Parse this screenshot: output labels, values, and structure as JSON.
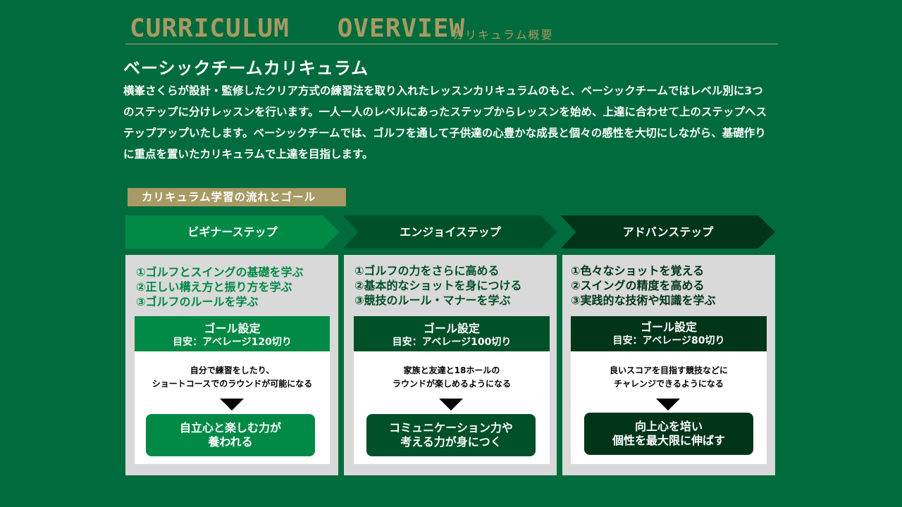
{
  "header": {
    "title_en": "CURRICULUM   OVERVIEW",
    "title_ja": "カリキュラム概要"
  },
  "course": {
    "title": "ベーシックチームカリキュラム",
    "intro": "横峯さくらが設計・監修したクリア方式の練習法を取り入れたレッスンカリキュラムのもと、ベーシックチームではレベル別に3つのステップに分けレッスンを行います。一人一人のレベルにあったステップからレッスンを始め、上達に合わせて上のステップへステップアップいたします。ベーシックチームでは、ゴルフを通して子供達の心豊かな成長と個々の感性を大切にしながら、基礎作りに重点を置いたカリキュラムで上達を目指します。"
  },
  "flow_label": "カリキュラム学習の流れとゴール",
  "colors": {
    "background": "#006b3c",
    "gold": "#a89a64",
    "step1": "#008a46",
    "step2": "#005028",
    "step3": "#003519"
  },
  "steps": [
    {
      "name": "ビギナーステップ",
      "points": [
        "①ゴルフとスイングの基礎を学ぶ",
        "②正しい構え方と振り方を学ぶ",
        "③ゴルフのルールを学ぶ"
      ],
      "goal_title": "ゴール設定",
      "goal_target": "目安：アベレージ120切り",
      "desc": [
        "自分で練習をしたり、",
        "ショートコースでのラウンドが可能になる"
      ],
      "result": [
        "自立心と楽しむ力が",
        "養われる"
      ]
    },
    {
      "name": "エンジョイステップ",
      "points": [
        "①ゴルフの力をさらに高める",
        "②基本的なショットを身につける",
        "③競技のルール・マナーを学ぶ"
      ],
      "goal_title": "ゴール設定",
      "goal_target": "目安：アベレージ100切り",
      "desc": [
        "家族と友達と18ホールの",
        "ラウンドが楽しめるようになる"
      ],
      "result": [
        "コミュニケーション力や",
        "考える力が身につく"
      ]
    },
    {
      "name": "アドバンステップ",
      "points": [
        "①色々なショットを覚える",
        "②スイングの精度を高める",
        "③実践的な技術や知識を学ぶ"
      ],
      "goal_title": "ゴール設定",
      "goal_target": "目安：アベレージ80切り",
      "desc": [
        "良いスコアを目指す競技などに",
        "チャレンジできるようになる"
      ],
      "result": [
        "向上心を培い",
        "個性を最大限に伸ばす"
      ]
    }
  ]
}
